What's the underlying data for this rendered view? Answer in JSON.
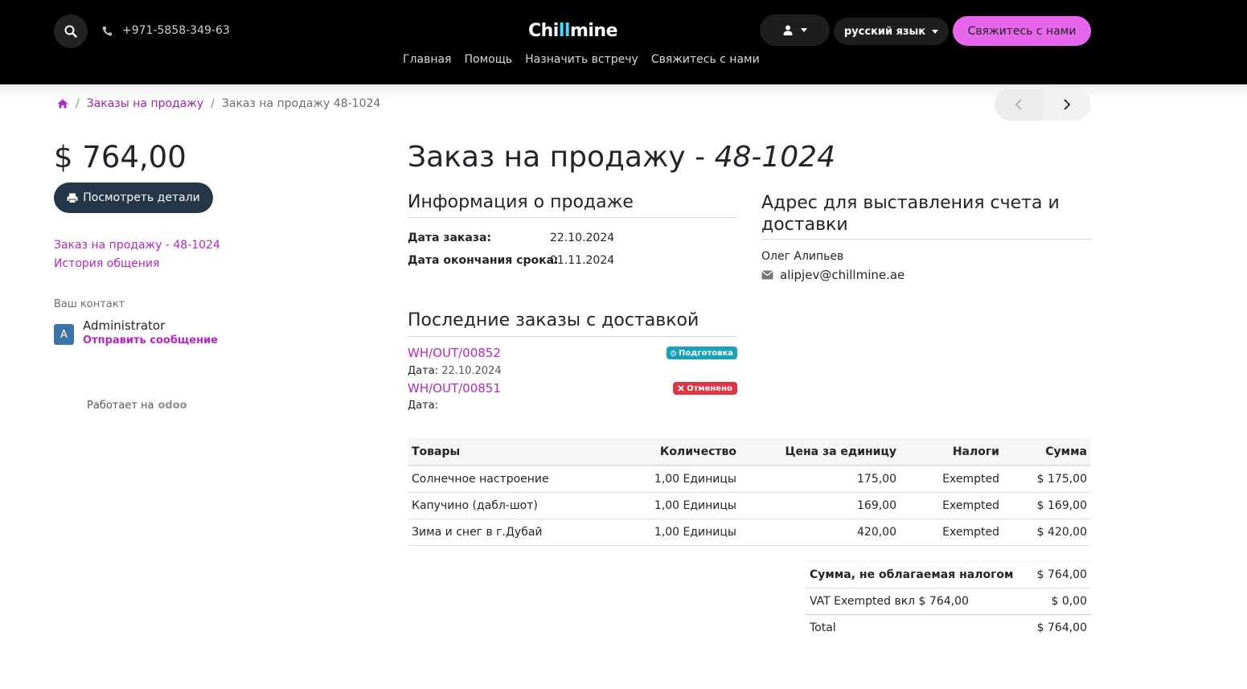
{
  "header": {
    "phone": "+971-5858-349-63",
    "logo": {
      "p1": "Chi",
      "p2": "ll",
      "p3": "mine"
    },
    "nav": [
      "Главная",
      "Помощь",
      "Назначить встречу",
      "Свяжитесь с нами"
    ],
    "language": "русский язык",
    "contact_button": "Свяжитесь с нами"
  },
  "breadcrumb": {
    "orders": "Заказы на продажу",
    "current": "Заказ на продажу 48-1024"
  },
  "sidebar": {
    "amount": "$ 764,00",
    "details_button": "Посмотреть детали",
    "link_order": "Заказ на продажу - 48-1024",
    "link_history": "История общения",
    "contact_label": "Ваш контакт",
    "avatar_letter": "A",
    "contact_name": "Administrator",
    "send_message": "Отправить сообщение",
    "powered_label": "Работает на",
    "powered_brand": "odoo"
  },
  "order": {
    "title_prefix": "Заказ на продажу - ",
    "title_number": "48-1024",
    "sale_info_title": "Информация о продаже",
    "order_date_label": "Дата заказа:",
    "order_date": "22.10.2024",
    "expiry_label": "Дата окончания срока:",
    "expiry_date": "01.11.2024",
    "billing_title": "Адрес для выставления счета и доставки",
    "billing_name": "Олег Алипьев",
    "billing_email": "alipjev@chillmine.ae",
    "deliveries_title": "Последние заказы с доставкой",
    "deliveries": [
      {
        "ref": "WH/OUT/00852",
        "date_label": "Дата:",
        "date": "22.10.2024",
        "status": "Подготовка"
      },
      {
        "ref": "WH/OUT/00851",
        "date_label": "Дата:",
        "date": "",
        "status": "Отменено"
      }
    ]
  },
  "table": {
    "headers": [
      "Товары",
      "Количество",
      "Цена за единицу",
      "Налоги",
      "Сумма"
    ],
    "rows": [
      [
        "Солнечное настроение",
        "1,00 Единицы",
        "175,00",
        "Exempted",
        "$ 175,00"
      ],
      [
        "Капучино (дабл-шот)",
        "1,00 Единицы",
        "169,00",
        "Exempted",
        "$ 169,00"
      ],
      [
        "Зима и снег в г.Дубай",
        "1,00 Единицы",
        "420,00",
        "Exempted",
        "$ 420,00"
      ]
    ]
  },
  "totals": [
    [
      "Сумма, не облагаемая налогом",
      "$ 764,00"
    ],
    [
      "VAT Exempted вкл $ 764,00",
      "$ 0,00"
    ],
    [
      "Total",
      "$ 764,00"
    ]
  ],
  "colors": {
    "accent": "#b327c4",
    "contact_button": "#e767ec",
    "dark_button": "#253746"
  }
}
